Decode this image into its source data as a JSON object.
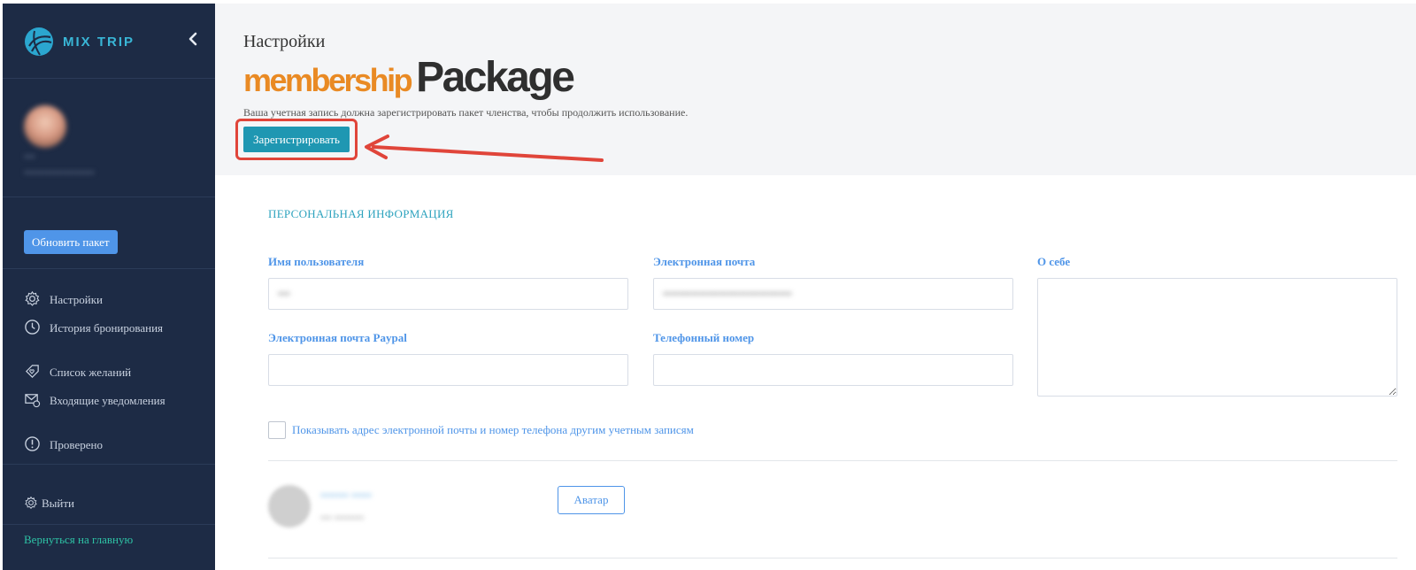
{
  "brand": {
    "name": "MIX TRIP",
    "accent": "#39b6d6"
  },
  "sidebar": {
    "user_name": "•••",
    "user_sub": "•••••••••••••••••••",
    "upgrade_label": "Обновить пакет",
    "items": [
      {
        "label": "Настройки",
        "icon": "gear-icon"
      },
      {
        "label": "История бронирования",
        "icon": "clock-icon"
      },
      {
        "label": "Список желаний",
        "icon": "wishlist-icon"
      },
      {
        "label": "Входящие уведомления",
        "icon": "mail-icon"
      },
      {
        "label": "Проверено",
        "icon": "info-icon"
      }
    ],
    "logout_label": "Выйти",
    "back_home_label": "Вернуться на главную"
  },
  "header": {
    "title": "Настройки",
    "logo_left": "membership",
    "logo_right": "Package",
    "notice": "Ваша учетная запись должна зарегистрировать пакет членства, чтобы продолжить использование.",
    "register_label": "Зарегистрировать"
  },
  "form": {
    "section_title": "ПЕРСОНАЛЬНАЯ ИНФОРМАЦИЯ",
    "username_label": "Имя пользователя",
    "username_value": "•••",
    "email_label": "Электронная почта",
    "email_value": "••••••••••••••••••••••••••••••••",
    "about_label": "О себе",
    "paypal_label": "Электронная почта Paypal",
    "phone_label": "Телефонный номер",
    "show_contact_label": "Показывать адрес электронной почты и номер телефона другим учетным записям",
    "avatar_name": "••••••• •••••",
    "avatar_sub": "••• ••••••••",
    "avatar_button": "Аватар"
  },
  "colors": {
    "sidebar_bg": "#1d2b45",
    "primary_button": "#1f97b2",
    "upgrade_button": "#4f95e8",
    "highlight": "#e0453a",
    "logo_orange": "#e98a24"
  }
}
